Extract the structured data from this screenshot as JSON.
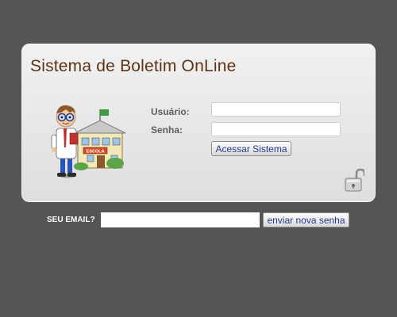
{
  "app": {
    "title": "Sistema de Boletim OnLine"
  },
  "illustration": {
    "building_label": "ESCOLA"
  },
  "login": {
    "user_label": "Usuário:",
    "user_value": "",
    "password_label": "Senha:",
    "password_value": "",
    "submit_label": "Acessar Sistema"
  },
  "recovery": {
    "email_label": "SEU EMAIL?",
    "email_value": "",
    "submit_label": "enviar nova senha"
  },
  "colors": {
    "background": "#555555",
    "panel": "#e8e8e8",
    "title": "#5e3314",
    "button_text": "#263a8a"
  }
}
